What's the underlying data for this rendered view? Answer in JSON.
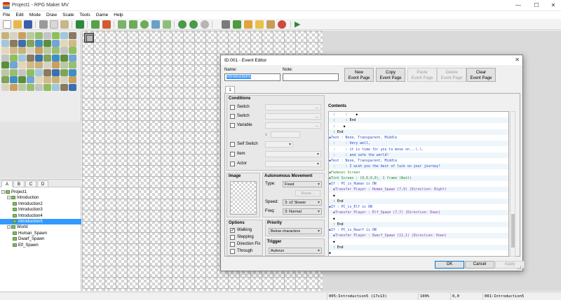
{
  "window": {
    "title": "Project1 - RPG Maker MV"
  },
  "menu": [
    "File",
    "Edit",
    "Mode",
    "Draw",
    "Scale",
    "Tools",
    "Game",
    "Help"
  ],
  "tileset_tabs": [
    "A",
    "B",
    "C",
    "D"
  ],
  "map_tree": [
    {
      "label": "Project1",
      "level": 0,
      "expander": "-"
    },
    {
      "label": "Introduction",
      "level": 1,
      "expander": "-"
    },
    {
      "label": "Introduction2",
      "level": 2
    },
    {
      "label": "Introduction3",
      "level": 2
    },
    {
      "label": "Introduction4",
      "level": 2
    },
    {
      "label": "Introduction5",
      "level": 2,
      "selected": true
    },
    {
      "label": "World",
      "level": 1,
      "expander": "-"
    },
    {
      "label": "Human_Spawn",
      "level": 2
    },
    {
      "label": "Dwarf_Spawn",
      "level": 2
    },
    {
      "label": "Elf_Spawn",
      "level": 2
    }
  ],
  "status": {
    "map": "005:Introduction5 (17x13)",
    "zoom": "100%",
    "coords": "0,0",
    "event": "001:Introduction5"
  },
  "dialog": {
    "title": "ID:001 - Event Editor",
    "name_label": "Name:",
    "name_value": "Introduction5",
    "note_label": "Note:",
    "note_value": "",
    "page_buttons": [
      {
        "l1": "New",
        "l2": "Event Page",
        "disabled": false
      },
      {
        "l1": "Copy",
        "l2": "Event Page",
        "disabled": false
      },
      {
        "l1": "Paste",
        "l2": "Event Page",
        "disabled": true
      },
      {
        "l1": "Delete",
        "l2": "Event Page",
        "disabled": true
      },
      {
        "l1": "Clear",
        "l2": "Event Page",
        "disabled": false
      }
    ],
    "page_tab": "1",
    "conditions": {
      "title": "Conditions",
      "switch1": "Switch",
      "switch2": "Switch",
      "variable": "Variable",
      "ge": "≥",
      "self_switch": "Self Switch",
      "item": "Item",
      "actor": "Actor"
    },
    "image_title": "Image",
    "autonomous": {
      "title": "Autonomous Movement",
      "type_label": "Type:",
      "type_value": "Fixed",
      "route": "Route...",
      "speed_label": "Speed:",
      "speed_value": "3: x2 Slower",
      "freq_label": "Freq:",
      "freq_value": "3: Normal"
    },
    "options": {
      "title": "Options",
      "walking": "Walking",
      "stepping": "Stepping",
      "direction_fix": "Direction Fix",
      "through": "Through"
    },
    "priority": {
      "title": "Priority",
      "value": "Below characters"
    },
    "trigger": {
      "title": "Trigger",
      "value": "Autorun"
    },
    "contents_title": "Contents",
    "contents": [
      {
        "t": "  :     :    ◆",
        "c": "n"
      },
      {
        "t": "  :     : End",
        "c": "n"
      },
      {
        "t": "  :    ◆",
        "c": "n"
      },
      {
        "t": "  : End",
        "c": "n"
      },
      {
        "t": "◆Text : None, Transparent, Middle",
        "c": "b"
      },
      {
        "t": "  :     : Very well,",
        "c": "b"
      },
      {
        "t": "  :     : it is time for you to move on...\\.\\.",
        "c": "b"
      },
      {
        "t": "  :     : and safe the world!",
        "c": "b"
      },
      {
        "t": "◆Text : None, Transparent, Middle",
        "c": "b"
      },
      {
        "t": "  :     : I wish you the best of luck on your journey!",
        "c": "b"
      },
      {
        "t": "◆Fadeout Screen",
        "c": "gr"
      },
      {
        "t": "◆Tint Screen : (0,0,0,0), 1 frame (Wait)",
        "c": "gr"
      },
      {
        "t": "◆If : PC_is_Human is ON",
        "c": "b"
      },
      {
        "t": "  ◆Transfer Player : Human_Spawn (7,9) (Direction: Right)",
        "c": "p"
      },
      {
        "t": "  ◆",
        "c": "n"
      },
      {
        "t": "  : End",
        "c": "n"
      },
      {
        "t": "◆If : PC_is_Elf is ON",
        "c": "b"
      },
      {
        "t": "  ◆Transfer Player : Elf_Spawn (7,7) (Direction: Down)",
        "c": "p"
      },
      {
        "t": "  ◆",
        "c": "n"
      },
      {
        "t": "  : End",
        "c": "n"
      },
      {
        "t": "◆If : PC_is_Dwarf is ON",
        "c": "b"
      },
      {
        "t": "  ◆Transfer Player : Dwarf_Spawn (11,1) (Direction: Down)",
        "c": "p"
      },
      {
        "t": "  ◆",
        "c": "n"
      },
      {
        "t": "  : End",
        "c": "n"
      },
      {
        "t": "◆",
        "c": "n"
      }
    ],
    "ok": "OK",
    "cancel": "Cancel",
    "apply": "Apply"
  }
}
